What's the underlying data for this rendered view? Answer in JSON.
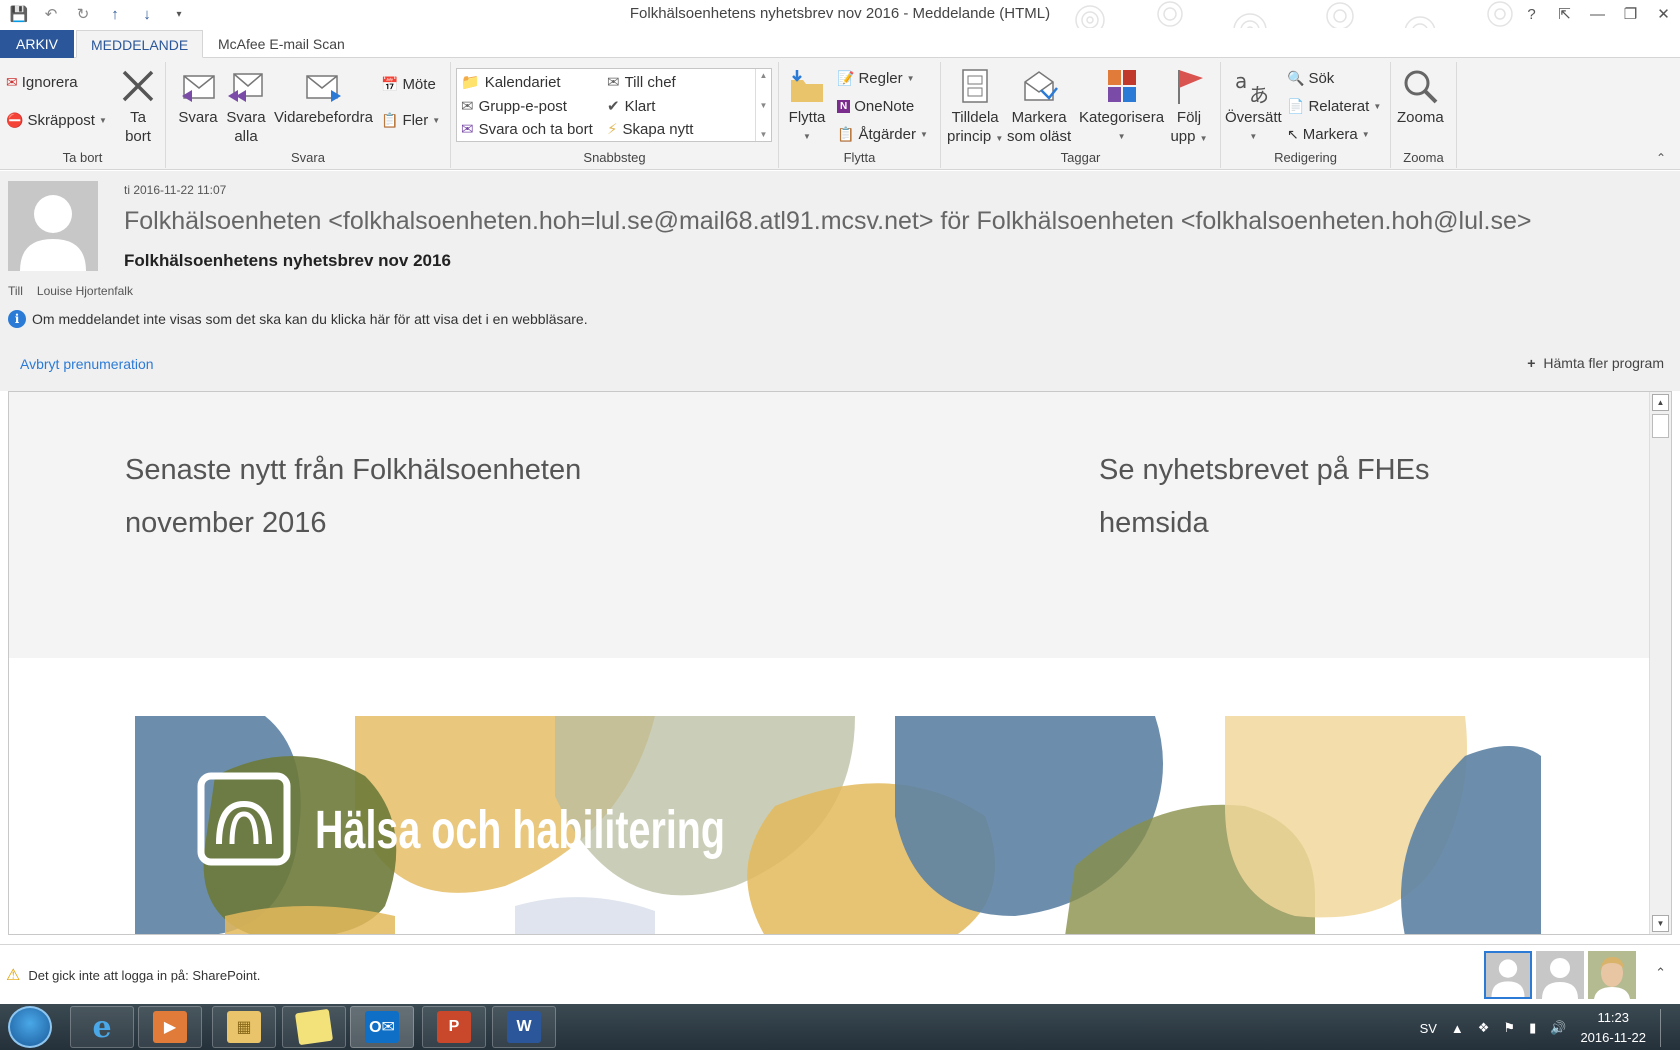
{
  "window": {
    "title": "Folkhälsoenhetens nyhetsbrev nov 2016 - Meddelande (HTML)",
    "help": "?",
    "controls": [
      "⇱",
      "—",
      "❐",
      "✕"
    ]
  },
  "tabs": {
    "file": "ARKIV",
    "message": "MEDDELANDE",
    "mcafee": "McAfee E-mail Scan"
  },
  "ribbon": {
    "delete_group": {
      "ignore": "Ignorera",
      "junk": "Skräppost",
      "delete_line1": "Ta",
      "delete_line2": "bort",
      "label": "Ta bort"
    },
    "respond_group": {
      "reply": "Svara",
      "reply_all_line1": "Svara",
      "reply_all_line2": "alla",
      "forward": "Vidarebefordra",
      "meeting": "Möte",
      "more": "Fler",
      "label": "Svara"
    },
    "quicksteps_group": {
      "items": [
        "Kalendariet",
        "Till chef",
        "Grupp-e-post",
        "Klart",
        "Svara och ta bort",
        "Skapa nytt"
      ],
      "label": "Snabbsteg"
    },
    "move_group": {
      "move": "Flytta",
      "rules": "Regler",
      "onenote": "OneNote",
      "actions": "Åtgärder",
      "label": "Flytta"
    },
    "tags_group": {
      "assign_line1": "Tilldela",
      "assign_line2": "princip",
      "unread_line1": "Markera",
      "unread_line2": "som oläst",
      "categorize": "Kategorisera",
      "follow_line1": "Följ",
      "follow_line2": "upp",
      "label": "Taggar"
    },
    "editing_group": {
      "translate": "Översätt",
      "find": "Sök",
      "related": "Relaterat",
      "select": "Markera",
      "label": "Redigering"
    },
    "zoom_group": {
      "zoom": "Zooma",
      "label": "Zooma"
    }
  },
  "message": {
    "date": "ti 2016-11-22 11:07",
    "from": "Folkhälsoenheten <folkhalsoenheten.hoh=lul.se@mail68.atl91.mcsv.net> för Folkhälsoenheten <folkhalsoenheten.hoh@lul.se>",
    "subject": "Folkhälsoenhetens nyhetsbrev nov 2016",
    "to_label": "Till",
    "to": "Louise Hjortenfalk",
    "info": "Om meddelandet inte visas som det ska kan du klicka här för att visa det i en webbläsare.",
    "unsubscribe": "Avbryt prenumeration",
    "more_programs": "Hämta fler program"
  },
  "body": {
    "headline_line1": "Senaste nytt från Folkhälsoenheten",
    "headline_line2": "november 2016",
    "link_line1": "Se nyhetsbrevet på FHEs",
    "link_line2": "hemsida",
    "banner_text": "Hälsa och habilitering"
  },
  "people_pane": {
    "warning": "Det gick inte att logga in på: SharePoint."
  },
  "taskbar": {
    "language": "SV",
    "time": "11:23",
    "date": "2016-11-22"
  },
  "colors": {
    "accent": "#2b579a",
    "link": "#2b7bd6",
    "banner_blue": "#5c82a3",
    "banner_olive": "#6e7a3a",
    "banner_gold": "#e3b95c",
    "banner_sage": "#b8bea0"
  }
}
